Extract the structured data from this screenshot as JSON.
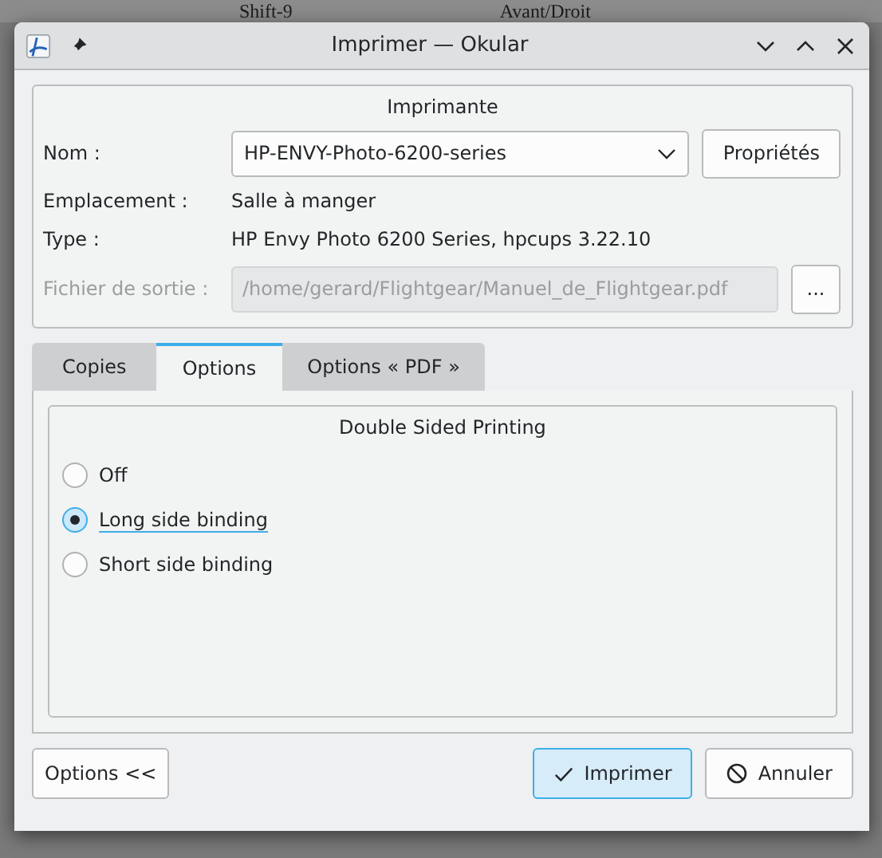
{
  "background": {
    "texts": [
      "Shift-9",
      "Avant/Droit"
    ]
  },
  "window": {
    "title": "Imprimer — Okular"
  },
  "printer": {
    "title": "Imprimante",
    "fields": [
      {
        "kind": "combo",
        "label": "Nom :",
        "value": "HP-ENVY-Photo-6200-series",
        "button": "Propriétés",
        "disabled": false
      },
      {
        "kind": "text",
        "label": "Emplacement :",
        "value": "Salle à manger",
        "disabled": false
      },
      {
        "kind": "text",
        "label": "Type :",
        "value": "HP Envy Photo 6200 Series, hpcups 3.22.10",
        "disabled": false
      },
      {
        "kind": "file",
        "label": "Fichier de sortie :",
        "value": "/home/gerard/Flightgear/Manuel_de_Flightgear.pdf",
        "button": "...",
        "disabled": true
      }
    ]
  },
  "tabs": [
    {
      "label": "Copies",
      "selected": false
    },
    {
      "label": "Options",
      "selected": true
    },
    {
      "label": "Options « PDF »",
      "selected": false
    }
  ],
  "duplex": {
    "title": "Double Sided Printing",
    "options": [
      {
        "label": "Off",
        "selected": false
      },
      {
        "label": "Long side binding",
        "selected": true
      },
      {
        "label": "Short side binding",
        "selected": false
      }
    ]
  },
  "buttons": [
    {
      "kind": "toggle",
      "label": "Options <<",
      "default": false
    },
    {
      "kind": "ok",
      "label": "Imprimer",
      "default": true
    },
    {
      "kind": "cancel",
      "label": "Annuler",
      "default": false
    }
  ]
}
